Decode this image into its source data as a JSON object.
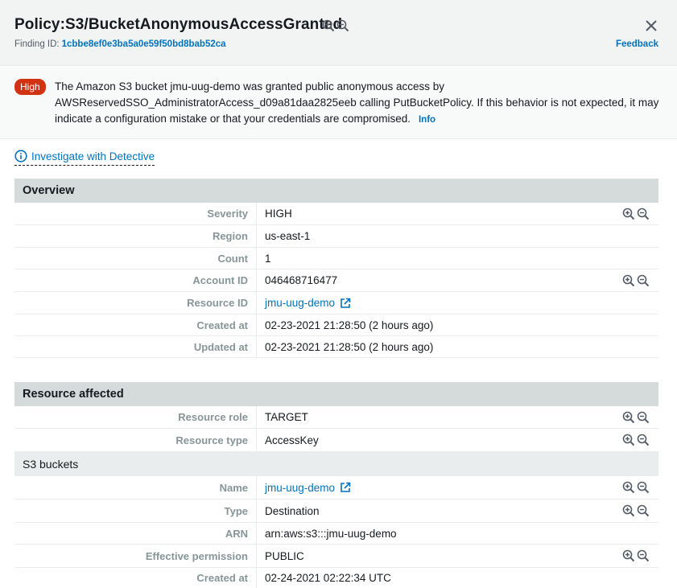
{
  "header": {
    "title": "Policy:S3/BucketAnonymousAccessGranted",
    "finding_id_label": "Finding ID:",
    "finding_id_value": "1cbbe8ef0e3ba5a0e59f50bd8bab52ca",
    "feedback": "Feedback"
  },
  "banner": {
    "severity_badge": "High",
    "message": "The Amazon S3 bucket jmu-uug-demo was granted public anonymous access by AWSReservedSSO_AdministratorAccess_d09a81daa2825eeb calling PutBucketPolicy. If this behavior is not expected, it may indicate a configuration mistake or that your credentials are compromised.",
    "info_link": "Info"
  },
  "investigate": {
    "label": "Investigate with Detective"
  },
  "overview": {
    "heading": "Overview",
    "rows": [
      {
        "label": "Severity",
        "value": "HIGH"
      },
      {
        "label": "Region",
        "value": "us-east-1"
      },
      {
        "label": "Count",
        "value": "1"
      },
      {
        "label": "Account ID",
        "value": "046468716477"
      },
      {
        "label": "Resource ID",
        "value": "jmu-uug-demo"
      },
      {
        "label": "Created at",
        "value": "02-23-2021 21:28:50 (2 hours ago)"
      },
      {
        "label": "Updated at",
        "value": "02-23-2021 21:28:50 (2 hours ago)"
      }
    ]
  },
  "resource": {
    "heading": "Resource affected",
    "rows": [
      {
        "label": "Resource role",
        "value": "TARGET"
      },
      {
        "label": "Resource type",
        "value": "AccessKey"
      }
    ]
  },
  "s3": {
    "heading": "S3 buckets",
    "rows": [
      {
        "label": "Name",
        "value": "jmu-uug-demo"
      },
      {
        "label": "Type",
        "value": "Destination"
      },
      {
        "label": "ARN",
        "value": "arn:aws:s3:::jmu-uug-demo"
      },
      {
        "label": "Effective permission",
        "value": "PUBLIC"
      },
      {
        "label": "Created at",
        "value": "02-24-2021 02:22:34 UTC"
      }
    ]
  },
  "colors": {
    "link": "#0073bb",
    "high_badge": "#d13212",
    "section_header": "#d5dbdb",
    "label_text": "#879596"
  },
  "icons": {
    "zoom_in": "zoom-in-icon",
    "zoom_out": "zoom-out-icon",
    "close": "close-icon",
    "external": "external-link-icon",
    "info": "info-circle-icon"
  }
}
